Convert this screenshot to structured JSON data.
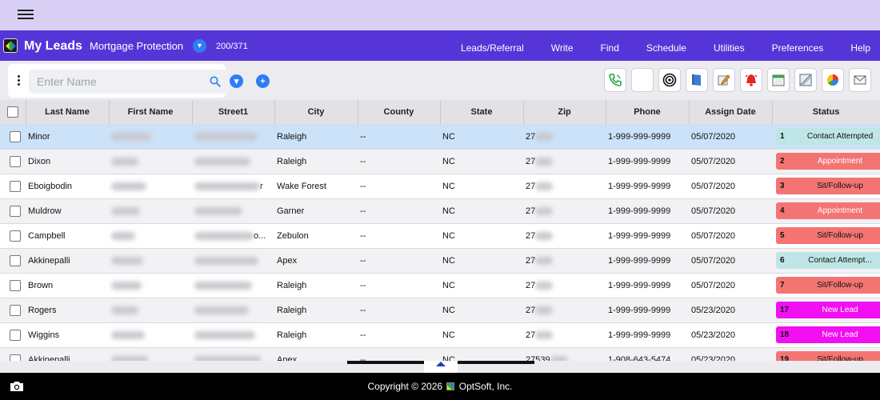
{
  "app": {
    "title": "My Leads",
    "campaign": "Mortgage Protection",
    "count": "200/371"
  },
  "menu": [
    "Leads/Referral",
    "Write",
    "Find",
    "Schedule",
    "Utilities",
    "Preferences",
    "Help"
  ],
  "search": {
    "placeholder": "Enter Name",
    "value": ""
  },
  "toolbar_icons": [
    "phone-icon",
    "blank-icon",
    "target-icon",
    "notebook-icon",
    "edit-icon",
    "alarm-bell-icon",
    "calendar-icon",
    "image-icon",
    "pie-chart-icon",
    "envelope-icon"
  ],
  "columns": [
    "Last Name",
    "First Name",
    "Street1",
    "City",
    "County",
    "State",
    "Zip",
    "Phone",
    "Assign Date",
    "Status"
  ],
  "rows": [
    {
      "last": "Minor",
      "street_tail": "",
      "city": "Raleigh",
      "county": "--",
      "state": "NC",
      "zip": "27",
      "phone": "1-999-999-9999",
      "date": "05/07/2020",
      "status_num": "1",
      "status": "Contact Attempted",
      "status_color": "#bfe6e6",
      "status_text_color": "#111111"
    },
    {
      "last": "Dixon",
      "street_tail": "",
      "city": "Raleigh",
      "county": "--",
      "state": "NC",
      "zip": "27",
      "phone": "1-999-999-9999",
      "date": "05/07/2020",
      "status_num": "2",
      "status": "Appointment",
      "status_color": "#f47474",
      "status_text_color": "#ffffff"
    },
    {
      "last": "Eboigbodin",
      "street_tail": "r",
      "city": "Wake Forest",
      "county": "--",
      "state": "NC",
      "zip": "27",
      "phone": "1-999-999-9999",
      "date": "05/07/2020",
      "status_num": "3",
      "status": "Sit/Follow-up",
      "status_color": "#f47474",
      "status_text_color": "#111111"
    },
    {
      "last": "Muldrow",
      "street_tail": "",
      "city": "Garner",
      "county": "--",
      "state": "NC",
      "zip": "27",
      "phone": "1-999-999-9999",
      "date": "05/07/2020",
      "status_num": "4",
      "status": "Appointment",
      "status_color": "#f47474",
      "status_text_color": "#ffffff"
    },
    {
      "last": "Campbell",
      "street_tail": "o...",
      "city": "Zebulon",
      "county": "--",
      "state": "NC",
      "zip": "27",
      "phone": "1-999-999-9999",
      "date": "05/07/2020",
      "status_num": "5",
      "status": "Sit/Follow-up",
      "status_color": "#f47474",
      "status_text_color": "#111111"
    },
    {
      "last": "Akkinepalli",
      "street_tail": "",
      "city": "Apex",
      "county": "--",
      "state": "NC",
      "zip": "27",
      "phone": "1-999-999-9999",
      "date": "05/07/2020",
      "status_num": "6",
      "status": "Contact Attempt...",
      "status_color": "#bfe6e6",
      "status_text_color": "#111111"
    },
    {
      "last": "Brown",
      "street_tail": "",
      "city": "Raleigh",
      "county": "--",
      "state": "NC",
      "zip": "27",
      "phone": "1-999-999-9999",
      "date": "05/07/2020",
      "status_num": "7",
      "status": "Sit/Follow-up",
      "status_color": "#f47474",
      "status_text_color": "#111111"
    },
    {
      "last": "Rogers",
      "street_tail": "",
      "city": "Raleigh",
      "county": "--",
      "state": "NC",
      "zip": "27",
      "phone": "1-999-999-9999",
      "date": "05/23/2020",
      "status_num": "17",
      "status": "New Lead",
      "status_color": "#f20ff2",
      "status_text_color": "#ffffff"
    },
    {
      "last": "Wiggins",
      "street_tail": "",
      "city": "Raleigh",
      "county": "--",
      "state": "NC",
      "zip": "27",
      "phone": "1-999-999-9999",
      "date": "05/23/2020",
      "status_num": "18",
      "status": "New Lead",
      "status_color": "#f20ff2",
      "status_text_color": "#ffffff"
    },
    {
      "last": "Akkinepalli",
      "street_tail": "",
      "city": "Apex",
      "county": "--",
      "state": "NC",
      "zip": "27539",
      "phone": "1-908-643-5474",
      "date": "05/23/2020",
      "status_num": "19",
      "status": "Sit/Follow-up",
      "status_color": "#f47474",
      "status_text_color": "#111111"
    }
  ],
  "footer": {
    "copyright": "Copyright © 2026",
    "company": "OptSoft, Inc."
  },
  "colors": {
    "topbar": "#d8cff4",
    "navbar": "#5635d8",
    "accent": "#2f7df6",
    "selected_row": "#cbe2f9"
  }
}
